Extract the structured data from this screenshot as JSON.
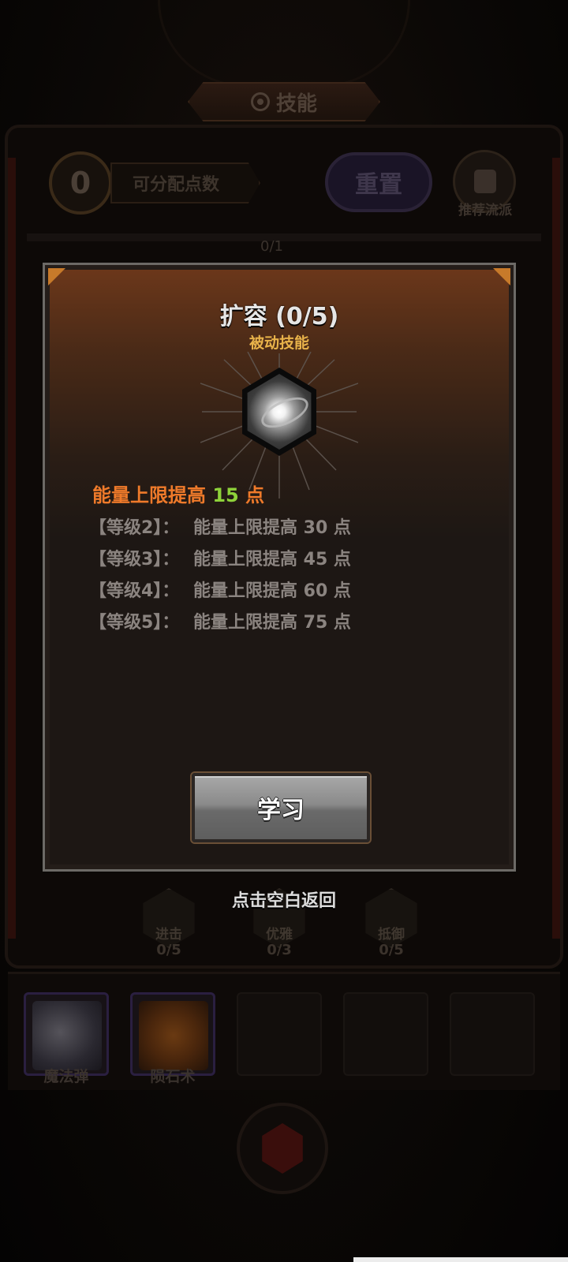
{
  "header": {
    "title": "技能",
    "title_icon": "gear-icon"
  },
  "toolbar": {
    "points_value": "0",
    "points_label": "可分配点数",
    "reset_label": "重置",
    "recommend_label": "推荐流派",
    "recommend_icon": "thumb-up-icon"
  },
  "tree": {
    "top_count": "0/1",
    "nodes": [
      {
        "label": "进击",
        "count": "0/5"
      },
      {
        "label": "优雅",
        "count": "0/3"
      },
      {
        "label": "抵御",
        "count": "0/5"
      }
    ]
  },
  "skillbar": {
    "slots": [
      {
        "label": "魔法弹",
        "icon": "magic-missile-icon"
      },
      {
        "label": "陨石术",
        "icon": "meteor-icon"
      }
    ]
  },
  "modal": {
    "title": "扩容 (0/5)",
    "type": "被动技能",
    "icon": "energy-orb-icon",
    "effect_prefix": "能量上限提高 ",
    "effect_value": "15",
    "effect_suffix": " 点",
    "levels": [
      {
        "name": "【等级2】：",
        "text": "能量上限提高 30 点"
      },
      {
        "name": "【等级3】：",
        "text": "能量上限提高 45 点"
      },
      {
        "name": "【等级4】：",
        "text": "能量上限提高 60 点"
      },
      {
        "name": "【等级5】：",
        "text": "能量上限提高 75 点"
      }
    ],
    "learn_label": "学习"
  },
  "dismiss_hint": "点击空白返回",
  "colors": {
    "accent_orange": "#ef7a2a",
    "value_green": "#8ed23a",
    "type_gold": "#e8b24a"
  }
}
